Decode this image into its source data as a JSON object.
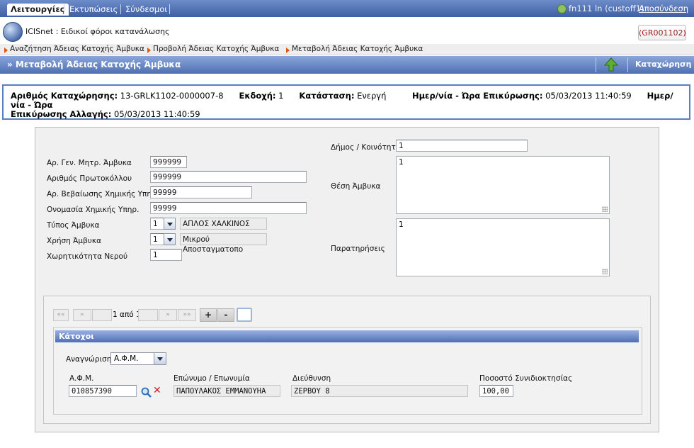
{
  "topnav": {
    "tabs": [
      "Λειτουργίες",
      "Εκτυπώσεις",
      "Σύνδεσμοι"
    ],
    "user": "fn111 ln (custoff1)",
    "logout": "Αποσύνδεση"
  },
  "app": {
    "title": "ICISnet : Ειδικοί φόροι κατανάλωσης",
    "code_button": "(GR001102)"
  },
  "breadcrumbs": [
    "Αναζήτηση Άδειας Κατοχής Άμβυκα",
    "Προβολή Άδειας Κατοχής Άμβυκα",
    "Μεταβολή Άδειας Κατοχής Άμβυκα"
  ],
  "page": {
    "title": "» Μεταβολή Άδειας Κατοχής Άμβυκα",
    "save_label": "Καταχώρηση"
  },
  "info": {
    "reg_label": "Αριθμός Καταχώρησης:",
    "reg_value": "13-GRLK1102-0000007-8",
    "version_label": "Εκδοχή:",
    "version_value": "1",
    "status_label": "Κατάσταση:",
    "status_value": "Ενεργή",
    "confirm_label": "Ημερ/νία - Ώρα Επικύρωσης:",
    "confirm_value": "05/03/2013 11:40:59",
    "change_label_a": "Ημερ/νία - Ώρα",
    "change_label_b": "Επικύρωσης Αλλαγής:",
    "change_value": "05/03/2013 11:40:59"
  },
  "form": {
    "gen_reg_label": "Αρ. Γεν. Μητρ. Άμβυκα",
    "gen_reg_value": "999999",
    "protocol_label": "Αριθμός Πρωτοκόλλου",
    "protocol_value": "999999",
    "chem_cert_label": "Αρ. Βεβαίωσης Χημικής Υπηρ.",
    "chem_cert_value": "99999",
    "chem_name_label": "Ονομασία Χημικής Υπηρ.",
    "chem_name_value": "99999",
    "type_label": "Τύπος Άμβυκα",
    "type_code": "1",
    "type_desc": "ΑΠΛΟΣ ΧΑΛΚΙΝΟΣ",
    "use_label": "Χρήση Άμβυκα",
    "use_code": "1",
    "use_desc": "Μικρού Αποσταγματοπο",
    "capacity_label": "Χωρητικότητα Νερού",
    "capacity_value": "1",
    "municipality_label": "Δήμος / Κοινότητα",
    "municipality_value": "1",
    "location_label": "Θέση Άμβυκα",
    "location_value": "1",
    "remarks_label": "Παρατηρήσεις",
    "remarks_value": "1"
  },
  "pager": {
    "first": "««",
    "prev": "«",
    "next": "»",
    "last": "»»",
    "text": "1 από 1",
    "add": "+",
    "remove": "-"
  },
  "owners": {
    "header": "Κάτοχοι",
    "id_label": "Αναγνώριση",
    "id_value": "Α.Φ.Μ.",
    "cols": {
      "afm": "Α.Φ.Μ.",
      "name": "Επώνυμο / Επωνυμία",
      "address": "Διεύθυνση",
      "share": "Ποσοστό Συνιδιοκτησίας"
    },
    "row": {
      "afm": "010857390",
      "name": "ΠΑΠΟΥΛΑΚΟΣ ΕΜΜΑΝΟΥΗΑ",
      "address": "ΖΕΡΒΟΥ 8",
      "share": "100,00"
    }
  },
  "colors": {
    "accent": "#4f6fb2",
    "code_text": "#9b1b1b"
  }
}
